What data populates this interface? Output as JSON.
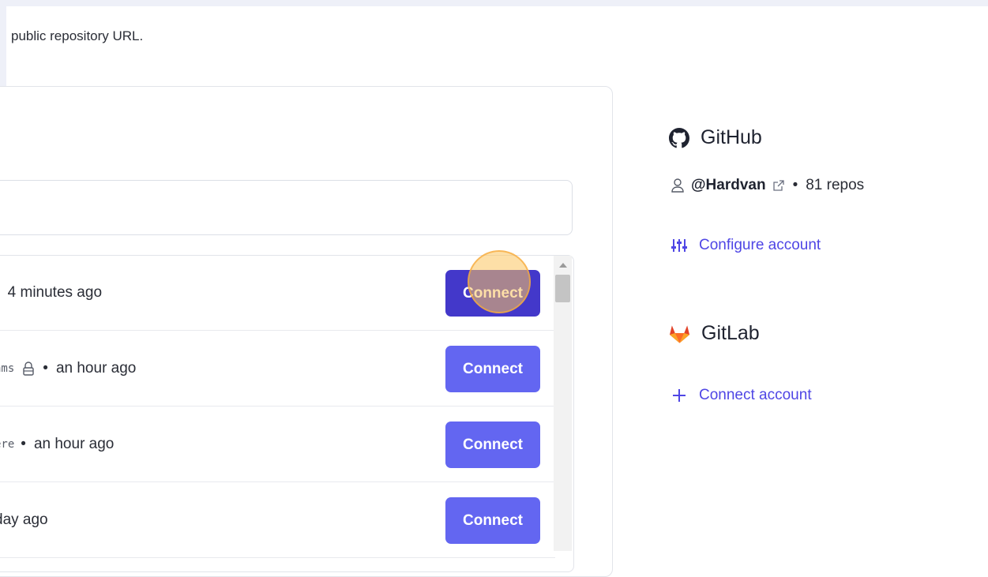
{
  "intro": {
    "text": "public repository URL."
  },
  "repositories": [
    {
      "name": "",
      "private": false,
      "updated": "4 minutes ago",
      "connect_label": "Connect",
      "state": "active"
    },
    {
      "name": "ams",
      "private": true,
      "updated": "an hour ago",
      "connect_label": "Connect",
      "state": "default"
    },
    {
      "name": "ere",
      "private": false,
      "updated": "an hour ago",
      "connect_label": "Connect",
      "state": "default"
    },
    {
      "name": "",
      "private": false,
      "updated": "day ago",
      "connect_label": "Connect",
      "state": "default"
    }
  ],
  "github": {
    "title": "GitHub",
    "icon": "github-icon",
    "handle": "@Hardvan",
    "separator": "•",
    "repo_count": "81 repos",
    "configure_label": "Configure account"
  },
  "gitlab": {
    "title": "GitLab",
    "icon": "gitlab-icon",
    "connect_label": "Connect account"
  },
  "colors": {
    "accent": "#6366f1",
    "accent_active": "#4338ca",
    "link": "#4f46e5",
    "background_band": "#eef0f8"
  }
}
